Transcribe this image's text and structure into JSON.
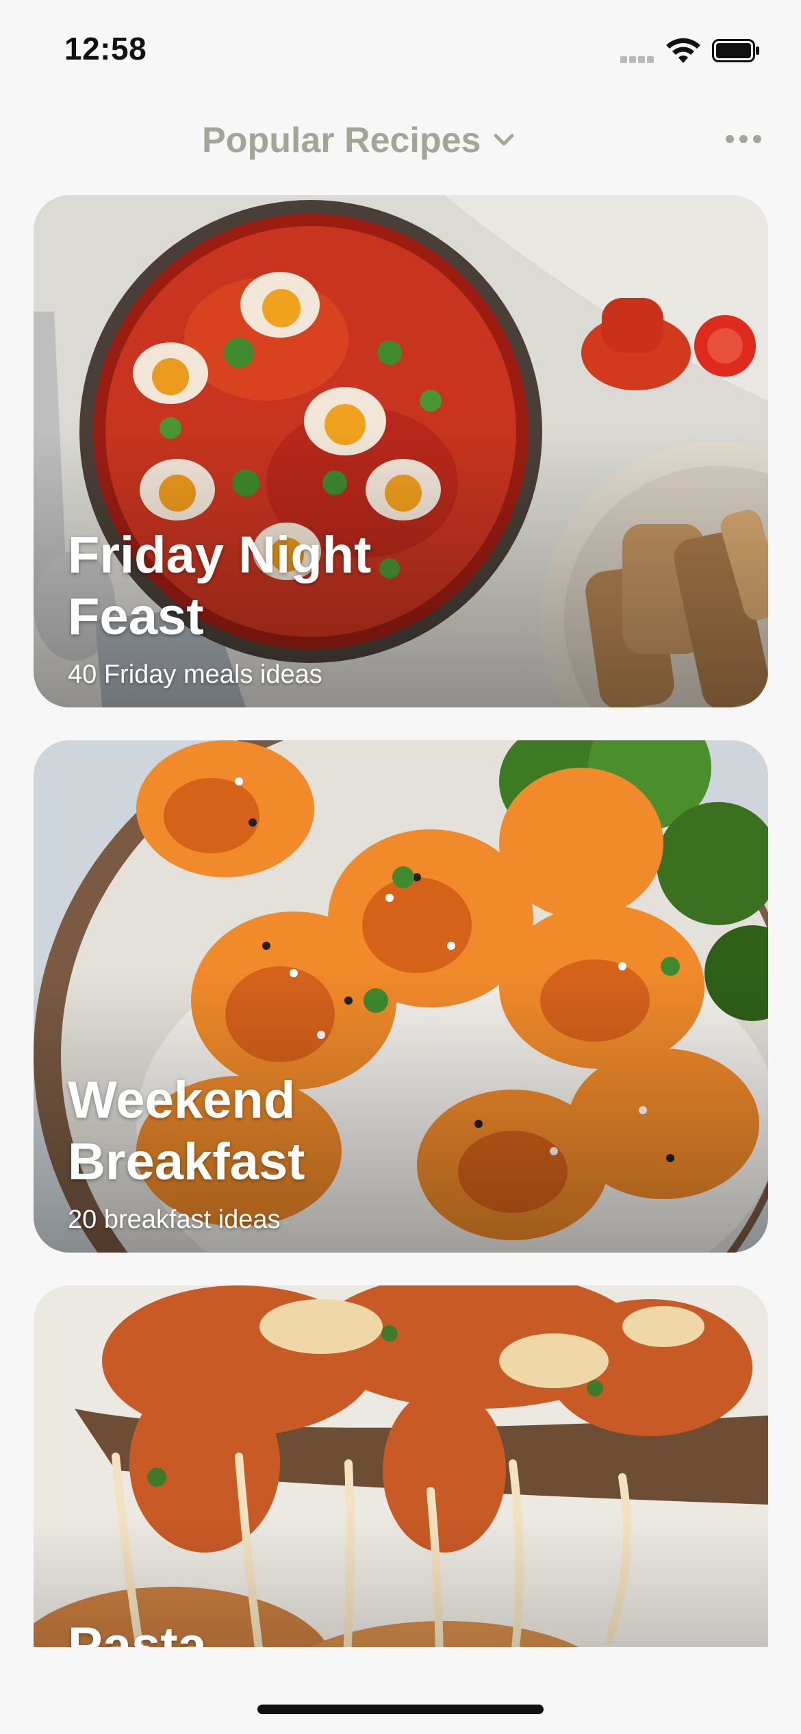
{
  "status_bar": {
    "time": "12:58"
  },
  "header": {
    "title": "Popular Recipes",
    "title_color": "#a5a597"
  },
  "cards": [
    {
      "title": "Friday Night Feast",
      "subtitle": "40 Friday meals ideas"
    },
    {
      "title": "Weekend Breakfast",
      "subtitle": "20 breakfast ideas"
    },
    {
      "title": "Pasta",
      "subtitle": ""
    }
  ],
  "icons": {
    "signal": "signal-dots-icon",
    "wifi": "wifi-icon",
    "battery": "battery-icon",
    "dropdown": "chevron-down-icon",
    "more": "more-horizontal-icon"
  }
}
